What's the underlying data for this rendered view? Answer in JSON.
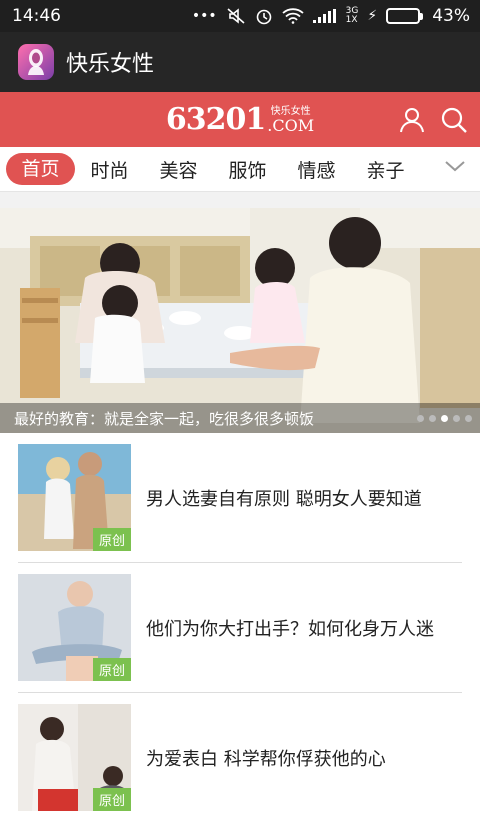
{
  "status": {
    "time": "14:46",
    "net_top": "3G",
    "net_bottom": "1X",
    "battery": "43%",
    "battery_level": 0.43
  },
  "app": {
    "title": "快乐女性"
  },
  "brand": {
    "number": "63201",
    "cn": "快乐女性",
    "dotcom": ".COM"
  },
  "tabs": [
    {
      "label": "首页",
      "active": true
    },
    {
      "label": "时尚"
    },
    {
      "label": "美容"
    },
    {
      "label": "服饰"
    },
    {
      "label": "情感"
    },
    {
      "label": "亲子"
    }
  ],
  "hero": {
    "caption": "最好的教育：就是全家一起，吃很多很多顿饭",
    "dots": 5,
    "active_dot": 2
  },
  "articles": [
    {
      "title": "男人选妻自有原则 聪明女人要知道",
      "badge": "原创"
    },
    {
      "title": "他们为你大打出手？如何化身万人迷",
      "badge": "原创"
    },
    {
      "title": "为爱表白 科学帮你俘获他的心",
      "badge": "原创"
    }
  ],
  "colors": {
    "brand_red": "#e05352",
    "badge_green": "#7cc14f",
    "appbar": "#262626"
  }
}
